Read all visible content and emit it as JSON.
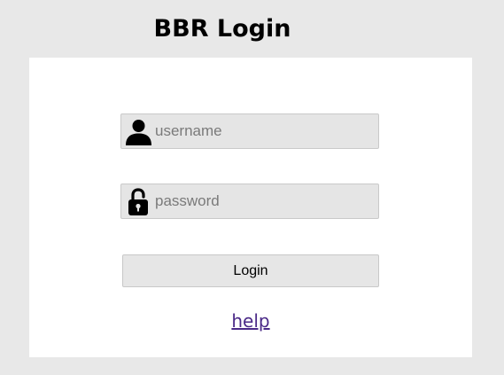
{
  "page": {
    "title": "BBR Login"
  },
  "form": {
    "username": {
      "placeholder": "username",
      "value": "",
      "icon": "user-icon"
    },
    "password": {
      "placeholder": "password",
      "value": "",
      "icon": "lock-icon"
    },
    "login_label": "Login",
    "help_label": "help"
  },
  "colors": {
    "background": "#e8e8e8",
    "panel": "#ffffff",
    "field": "#e5e5e5",
    "link": "#4b2a88"
  }
}
